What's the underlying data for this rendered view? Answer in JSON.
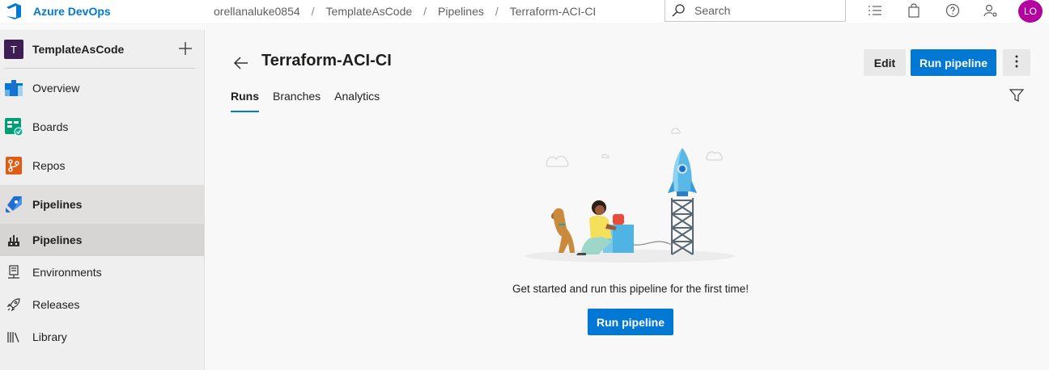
{
  "topbar": {
    "brand": "Azure DevOps",
    "breadcrumbs": [
      "orellanaluke0854",
      "TemplateAsCode",
      "Pipelines",
      "Terraform-ACI-CI"
    ],
    "breadcrumb_separator": "/",
    "search_placeholder": "Search",
    "avatar_initials": "LO",
    "avatar_color": "#b4009e"
  },
  "sidebar": {
    "project": {
      "badge": "T",
      "name": "TemplateAsCode"
    },
    "items": [
      {
        "label": "Overview",
        "icon": "overview-icon"
      },
      {
        "label": "Boards",
        "icon": "boards-icon"
      },
      {
        "label": "Repos",
        "icon": "repos-icon"
      },
      {
        "label": "Pipelines",
        "icon": "pipelines-icon"
      }
    ],
    "sub_items": [
      {
        "label": "Pipelines",
        "icon": "pipelines-sub-icon"
      },
      {
        "label": "Environments",
        "icon": "environments-icon"
      },
      {
        "label": "Releases",
        "icon": "releases-icon"
      },
      {
        "label": "Library",
        "icon": "library-icon"
      }
    ]
  },
  "main": {
    "title": "Terraform-ACI-CI",
    "edit_label": "Edit",
    "run_label": "Run pipeline",
    "tabs": [
      "Runs",
      "Branches",
      "Analytics"
    ],
    "active_tab": "Runs",
    "empty_message": "Get started and run this pipeline for the first time!",
    "empty_run_label": "Run pipeline"
  },
  "colors": {
    "accent": "#0078d4",
    "project_badge": "#3e1d54"
  }
}
